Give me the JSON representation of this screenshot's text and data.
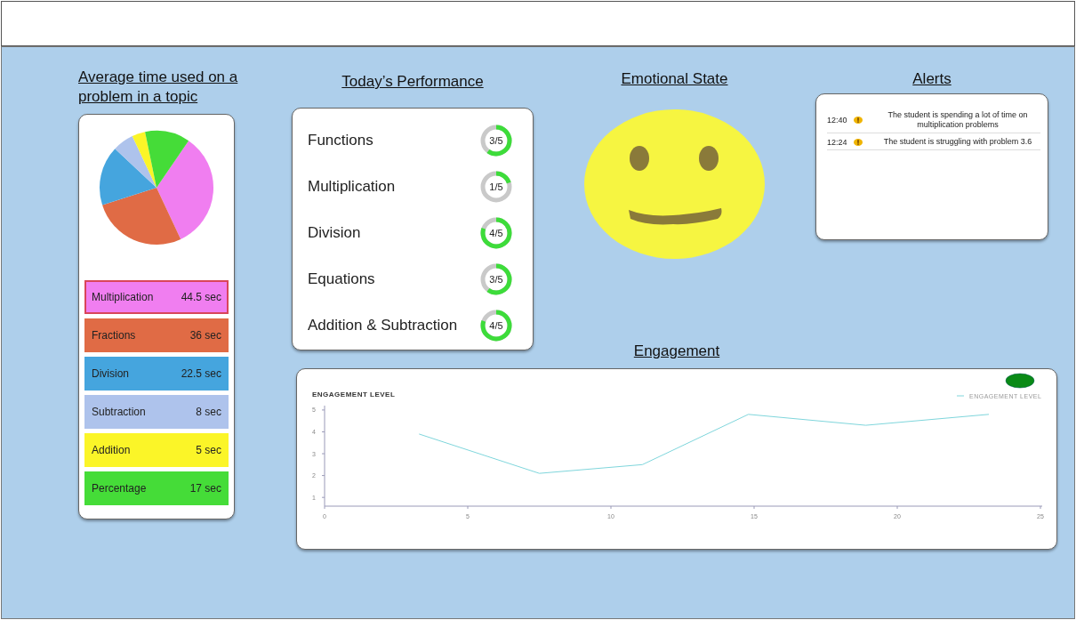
{
  "time_per_topic": {
    "title": "Average time used on a problem in a topic",
    "topics": [
      {
        "name": "Multiplication",
        "time": "44.5 sec",
        "color": "#f07ef0",
        "selected": true
      },
      {
        "name": "Fractions",
        "time": "36 sec",
        "color": "#e06b45",
        "selected": false
      },
      {
        "name": "Division",
        "time": "22.5 sec",
        "color": "#45a5de",
        "selected": false
      },
      {
        "name": "Subtraction",
        "time": "8 sec",
        "color": "#aec3ec",
        "selected": false
      },
      {
        "name": "Addition",
        "time": "5 sec",
        "color": "#fbf528",
        "selected": false
      },
      {
        "name": "Percentage",
        "time": "17 sec",
        "color": "#45dc38",
        "selected": false
      }
    ]
  },
  "performance": {
    "title": "Today’s Performance",
    "items": [
      {
        "topic": "Functions",
        "score": "3/5",
        "level": 0.6
      },
      {
        "topic": "Multiplication",
        "score": "1/5",
        "level": 0.2
      },
      {
        "topic": "Division",
        "score": "4/5",
        "level": 0.8
      },
      {
        "topic": "Equations",
        "score": "3/5",
        "level": 0.6
      },
      {
        "topic": "Addition & Subtraction",
        "score": "4/5",
        "level": 0.8
      }
    ]
  },
  "emotional_state": {
    "title": "Emotional State"
  },
  "alerts": {
    "title": "Alerts",
    "items": [
      {
        "time": "12:40",
        "message": "The student is spending a lot of time on multiplication problems"
      },
      {
        "time": "12:24",
        "message": "The student is struggling with problem 3.6"
      }
    ]
  },
  "engagement": {
    "title": "Engagement",
    "chart_data": {
      "type": "line",
      "title": "ENGAGEMENT LEVEL",
      "xlim": [
        0,
        25
      ],
      "ylim": [
        0.6,
        5.2
      ],
      "xticks": [
        0,
        5,
        10,
        15,
        20,
        25
      ],
      "yticks": [
        1,
        2,
        3,
        4,
        5
      ],
      "x": [
        3.3,
        7.5,
        11.1,
        14.8,
        18.9,
        23.2
      ],
      "series": [
        {
          "name": "ENGAGEMENT LEVEL",
          "color": "#7fd6dc",
          "values": [
            3.9,
            2.1,
            2.5,
            4.8,
            4.3,
            4.8
          ]
        }
      ]
    }
  }
}
